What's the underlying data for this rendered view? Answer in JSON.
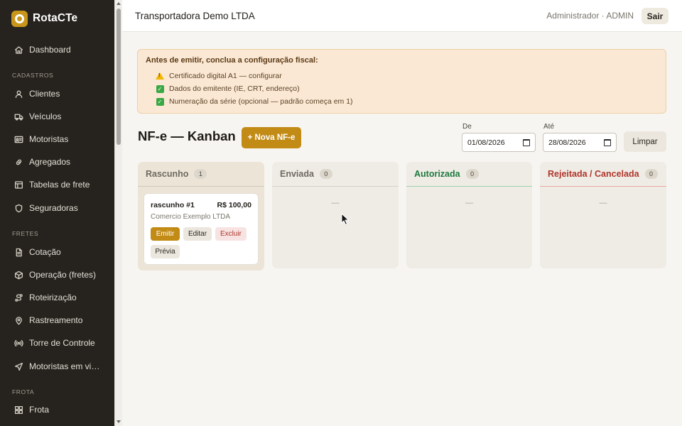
{
  "sidebar": {
    "brand": "RotaCTe",
    "items_top": [
      {
        "label": "Dashboard",
        "icon": "home-icon"
      }
    ],
    "sections": [
      {
        "title": "CADASTROS",
        "items": [
          {
            "label": "Clientes",
            "icon": "user-icon"
          },
          {
            "label": "Veículos",
            "icon": "truck-icon"
          },
          {
            "label": "Motoristas",
            "icon": "id-card-icon"
          },
          {
            "label": "Agregados",
            "icon": "link-icon"
          },
          {
            "label": "Tabelas de frete",
            "icon": "table-icon"
          },
          {
            "label": "Seguradoras",
            "icon": "shield-icon"
          }
        ]
      },
      {
        "title": "FRETES",
        "items": [
          {
            "label": "Cotação",
            "icon": "document-icon"
          },
          {
            "label": "Operação (fretes)",
            "icon": "package-icon"
          },
          {
            "label": "Roteirização",
            "icon": "route-icon"
          },
          {
            "label": "Rastreamento",
            "icon": "map-pin-icon"
          },
          {
            "label": "Torre de Controle",
            "icon": "broadcast-icon"
          },
          {
            "label": "Motoristas em viag...",
            "icon": "navigation-icon"
          }
        ]
      },
      {
        "title": "FROTA",
        "items": [
          {
            "label": "Frota",
            "icon": "grid-icon"
          }
        ]
      }
    ]
  },
  "header": {
    "company": "Transportadora Demo LTDA",
    "user": "Administrador · ADMIN",
    "logout_label": "Sair"
  },
  "alert": {
    "title": "Antes de emitir, conclua a configuração fiscal:",
    "items": [
      {
        "text": "Certificado digital A1 — configurar",
        "status": "warning"
      },
      {
        "text": "Dados do emitente (IE, CRT, endereço)",
        "status": "done"
      },
      {
        "text": "Numeração da série (opcional — padrão começa em 1)",
        "status": "done"
      }
    ]
  },
  "toolbar": {
    "title": "NF-e — Kanban",
    "new_label": "+ Nova NF-e",
    "from_label": "De",
    "from_value": "01/08/2026",
    "to_label": "Até",
    "to_value": "28/08/2026",
    "clear_label": "Limpar"
  },
  "kanban": {
    "columns": [
      {
        "title": "Rascunho",
        "count": "1",
        "color": "#6f6a61",
        "border": "#cfc7b8"
      },
      {
        "title": "Enviada",
        "count": "0",
        "color": "#6f6a61",
        "border": "#d6d1c7",
        "empty": "—"
      },
      {
        "title": "Autorizada",
        "count": "0",
        "color": "#1f7a3e",
        "border": "#9fd3ad",
        "empty": "—"
      },
      {
        "title": "Rejeitada / Cancelada",
        "count": "0",
        "color": "#b0362c",
        "border": "#e8a8a0",
        "empty": "—"
      }
    ],
    "card": {
      "name": "rascunho #1",
      "value": "R$ 100,00",
      "client": "Comercio Exemplo LTDA",
      "emit_label": "Emitir",
      "edit_label": "Editar",
      "delete_label": "Excluir",
      "preview_label": "Prévia"
    }
  },
  "colors": {
    "sidebar_bg": "#26231e",
    "accent": "#c28b16",
    "alert_bg": "#fbe8d4"
  }
}
